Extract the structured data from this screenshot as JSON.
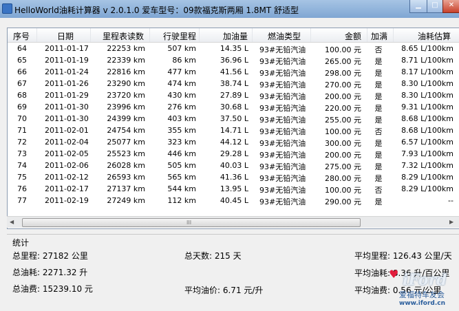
{
  "window": {
    "title": "HelloWorld油耗计算器 v 2.0.1.0  爱车型号：09款福克斯两厢 1.8MT 舒适型"
  },
  "table": {
    "columns": [
      "序号",
      "日期",
      "里程表读数",
      "行驶里程",
      "加油量",
      "燃油类型",
      "金额",
      "加满",
      "油耗估算"
    ],
    "rows": [
      {
        "no": "64",
        "date": "2011-01-17",
        "odo": "22253 km",
        "dist": "507 km",
        "fuel": "14.35 L",
        "type": "93#无铅汽油",
        "amount": "100.00 元",
        "full": "否",
        "cons": "8.65 L/100km"
      },
      {
        "no": "65",
        "date": "2011-01-19",
        "odo": "22339 km",
        "dist": "86 km",
        "fuel": "36.96 L",
        "type": "93#无铅汽油",
        "amount": "265.00 元",
        "full": "是",
        "cons": "8.71 L/100km"
      },
      {
        "no": "66",
        "date": "2011-01-24",
        "odo": "22816 km",
        "dist": "477 km",
        "fuel": "41.56 L",
        "type": "93#无铅汽油",
        "amount": "298.00 元",
        "full": "是",
        "cons": "8.17 L/100km"
      },
      {
        "no": "67",
        "date": "2011-01-26",
        "odo": "23290 km",
        "dist": "474 km",
        "fuel": "38.74 L",
        "type": "93#无铅汽油",
        "amount": "270.00 元",
        "full": "是",
        "cons": "8.30 L/100km"
      },
      {
        "no": "68",
        "date": "2011-01-29",
        "odo": "23720 km",
        "dist": "430 km",
        "fuel": "27.89 L",
        "type": "93#无铅汽油",
        "amount": "200.00 元",
        "full": "是",
        "cons": "8.30 L/100km"
      },
      {
        "no": "69",
        "date": "2011-01-30",
        "odo": "23996 km",
        "dist": "276 km",
        "fuel": "30.68 L",
        "type": "93#无铅汽油",
        "amount": "220.00 元",
        "full": "是",
        "cons": "9.31 L/100km"
      },
      {
        "no": "70",
        "date": "2011-01-30",
        "odo": "24399 km",
        "dist": "403 km",
        "fuel": "37.50 L",
        "type": "93#无铅汽油",
        "amount": "255.00 元",
        "full": "是",
        "cons": "8.68 L/100km"
      },
      {
        "no": "71",
        "date": "2011-02-01",
        "odo": "24754 km",
        "dist": "355 km",
        "fuel": "14.71 L",
        "type": "93#无铅汽油",
        "amount": "100.00 元",
        "full": "否",
        "cons": "8.68 L/100km"
      },
      {
        "no": "72",
        "date": "2011-02-04",
        "odo": "25077 km",
        "dist": "323 km",
        "fuel": "44.12 L",
        "type": "93#无铅汽油",
        "amount": "300.00 元",
        "full": "是",
        "cons": "6.57 L/100km"
      },
      {
        "no": "73",
        "date": "2011-02-05",
        "odo": "25523 km",
        "dist": "446 km",
        "fuel": "29.28 L",
        "type": "93#无铅汽油",
        "amount": "200.00 元",
        "full": "是",
        "cons": "7.93 L/100km"
      },
      {
        "no": "74",
        "date": "2011-02-06",
        "odo": "26028 km",
        "dist": "505 km",
        "fuel": "40.03 L",
        "type": "93#无铅汽油",
        "amount": "275.00 元",
        "full": "是",
        "cons": "7.32 L/100km"
      },
      {
        "no": "75",
        "date": "2011-02-12",
        "odo": "26593 km",
        "dist": "565 km",
        "fuel": "41.36 L",
        "type": "93#无铅汽油",
        "amount": "280.00 元",
        "full": "是",
        "cons": "8.29 L/100km"
      },
      {
        "no": "76",
        "date": "2011-02-17",
        "odo": "27137 km",
        "dist": "544 km",
        "fuel": "13.95 L",
        "type": "93#无铅汽油",
        "amount": "100.00 元",
        "full": "否",
        "cons": "8.29 L/100km"
      },
      {
        "no": "77",
        "date": "2011-02-19",
        "odo": "27249 km",
        "dist": "112 km",
        "fuel": "40.45 L",
        "type": "93#无铅汽油",
        "amount": "290.00 元",
        "full": "是",
        "cons": "--"
      }
    ]
  },
  "scrollbar": {
    "left_arrow": "◀",
    "right_arrow": "▶",
    "grip": "III"
  },
  "stats": {
    "title": "统计",
    "total_distance": "总里程: 27182 公里",
    "total_fuel": "总油耗: 2271.32 升",
    "total_cost": "总油费: 15239.10 元",
    "total_days": "总天数: 215 天",
    "avg_price": "平均油价: 6.71 元/升",
    "avg_distance": "平均里程: 126.43 公里/天",
    "avg_fuel": "平均油耗: 8.36 升/百公里",
    "avg_cost": "平均油费: 0.56 元/公里"
  },
  "watermark": {
    "word": "iFord",
    "cn": "爱福特车友会",
    "url": "www.iford.cn"
  }
}
